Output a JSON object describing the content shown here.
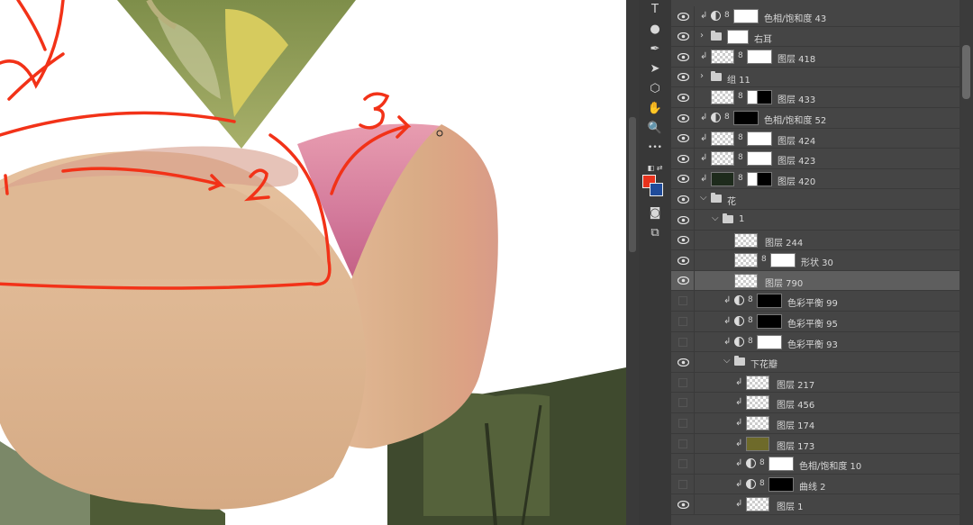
{
  "canvas": {
    "annotations": [
      "3",
      "2",
      "1"
    ]
  },
  "tools": [
    {
      "icon": "type-tool-icon",
      "glyph": "T"
    },
    {
      "icon": "blur-tool-icon",
      "glyph": "●"
    },
    {
      "icon": "pen-tool-icon",
      "glyph": "✒"
    },
    {
      "icon": "path-select-tool-icon",
      "glyph": "➤"
    },
    {
      "icon": "shape-tool-icon",
      "glyph": "⬡"
    },
    {
      "icon": "hand-tool-icon",
      "glyph": "✋"
    },
    {
      "icon": "zoom-tool-icon",
      "glyph": "🔍"
    },
    {
      "icon": "more-tools-icon",
      "glyph": "•••"
    }
  ],
  "colors": {
    "foreground": "#e8321c",
    "background": "#1f4b9a"
  },
  "layers": [
    {
      "name": "色相/饱和度 43",
      "visible": true,
      "indent": 0,
      "kind": "adjustment",
      "clipped": true
    },
    {
      "name": "右耳",
      "visible": true,
      "indent": 0,
      "kind": "group",
      "collapsed": true
    },
    {
      "name": "图层 418",
      "visible": true,
      "indent": 0,
      "kind": "layer-mask",
      "clipped": true
    },
    {
      "name": "组 11",
      "visible": true,
      "indent": 0,
      "kind": "group",
      "collapsed": true
    },
    {
      "name": "图层 433",
      "visible": true,
      "indent": 0,
      "kind": "layer-mask"
    },
    {
      "name": "色相/饱和度 52",
      "visible": true,
      "indent": 0,
      "kind": "adjustment",
      "clipped": true
    },
    {
      "name": "图层 424",
      "visible": true,
      "indent": 0,
      "kind": "layer-mask",
      "clipped": true
    },
    {
      "name": "图层 423",
      "visible": true,
      "indent": 0,
      "kind": "layer-mask",
      "clipped": true
    },
    {
      "name": "图层 420",
      "visible": true,
      "indent": 0,
      "kind": "layer-mask",
      "clipped": true
    },
    {
      "name": "花",
      "visible": true,
      "indent": 0,
      "kind": "group",
      "collapsed": false
    },
    {
      "name": "1",
      "visible": true,
      "indent": 1,
      "kind": "group",
      "collapsed": false
    },
    {
      "name": "图层 244",
      "visible": true,
      "indent": 2,
      "kind": "layer"
    },
    {
      "name": "形状 30",
      "visible": true,
      "indent": 2,
      "kind": "shape"
    },
    {
      "name": "图层 790",
      "visible": true,
      "indent": 2,
      "kind": "layer",
      "selected": true
    },
    {
      "name": "色彩平衡 99",
      "visible": false,
      "indent": 2,
      "kind": "adjustment",
      "clipped": true
    },
    {
      "name": "色彩平衡 95",
      "visible": false,
      "indent": 2,
      "kind": "adjustment",
      "clipped": true
    },
    {
      "name": "色彩平衡 93",
      "visible": false,
      "indent": 2,
      "kind": "adjustment",
      "clipped": true
    },
    {
      "name": "下花瓣",
      "visible": true,
      "indent": 2,
      "kind": "group",
      "collapsed": false
    },
    {
      "name": "图层 217",
      "visible": false,
      "indent": 3,
      "kind": "layer",
      "clipped": true
    },
    {
      "name": "图层 456",
      "visible": false,
      "indent": 3,
      "kind": "layer",
      "clipped": true
    },
    {
      "name": "图层 174",
      "visible": false,
      "indent": 3,
      "kind": "layer",
      "clipped": true
    },
    {
      "name": "图层 173",
      "visible": false,
      "indent": 3,
      "kind": "solid",
      "clipped": true
    },
    {
      "name": "色相/饱和度 10",
      "visible": false,
      "indent": 3,
      "kind": "adjustment",
      "clipped": true
    },
    {
      "name": "曲线 2",
      "visible": false,
      "indent": 3,
      "kind": "adjustment",
      "clipped": true
    },
    {
      "name": "图层 1",
      "visible": true,
      "indent": 3,
      "kind": "layer",
      "clipped": true
    }
  ]
}
